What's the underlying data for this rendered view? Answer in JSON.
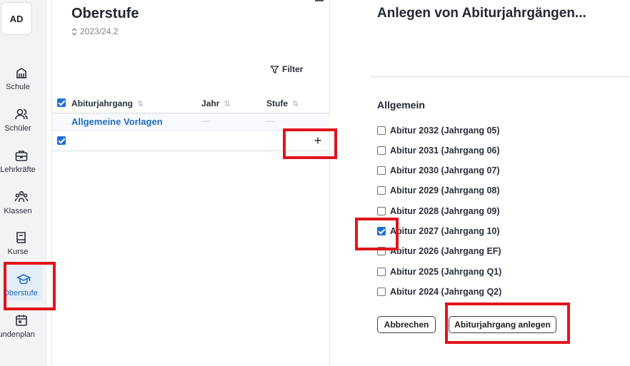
{
  "sidebar": {
    "avatar": "AD",
    "items": [
      {
        "label": "Schule",
        "icon": "building-icon"
      },
      {
        "label": "Schüler",
        "icon": "users-icon"
      },
      {
        "label": "Lehrkräfte",
        "icon": "briefcase-icon"
      },
      {
        "label": "Klassen",
        "icon": "group-icon"
      },
      {
        "label": "Kurse",
        "icon": "book-icon"
      },
      {
        "label": "Oberstufe",
        "icon": "graduation-cap-icon",
        "active": true
      },
      {
        "label": "Stundenplan",
        "icon": "calendar-icon"
      }
    ]
  },
  "list": {
    "title": "Oberstufe",
    "school_year": "2023/24.2",
    "filter_label": "Filter",
    "columns": [
      "Abiturjahrgang",
      "Jahr",
      "Stufe"
    ],
    "rows": [
      {
        "name": "Allgemeine Vorlagen",
        "jahr": "—",
        "stufe": "—"
      }
    ],
    "add_label": "+"
  },
  "form": {
    "title": "Anlegen von Abiturjahrgängen...",
    "section": "Allgemein",
    "options": [
      {
        "label": "Abitur 2032 (Jahrgang 05)",
        "checked": false
      },
      {
        "label": "Abitur 2031 (Jahrgang 06)",
        "checked": false
      },
      {
        "label": "Abitur 2030 (Jahrgang 07)",
        "checked": false
      },
      {
        "label": "Abitur 2029 (Jahrgang 08)",
        "checked": false
      },
      {
        "label": "Abitur 2028 (Jahrgang 09)",
        "checked": false
      },
      {
        "label": "Abitur 2027 (Jahrgang 10)",
        "checked": true
      },
      {
        "label": "Abitur 2026 (Jahrgang EF)",
        "checked": false
      },
      {
        "label": "Abitur 2025 (Jahrgang Q1)",
        "checked": false
      },
      {
        "label": "Abitur 2024 (Jahrgang Q2)",
        "checked": false
      }
    ],
    "cancel_label": "Abbrechen",
    "submit_label": "Abiturjahrgang anlegen"
  },
  "colors": {
    "accent": "#1f6fc0",
    "highlight": "#e1141b"
  }
}
